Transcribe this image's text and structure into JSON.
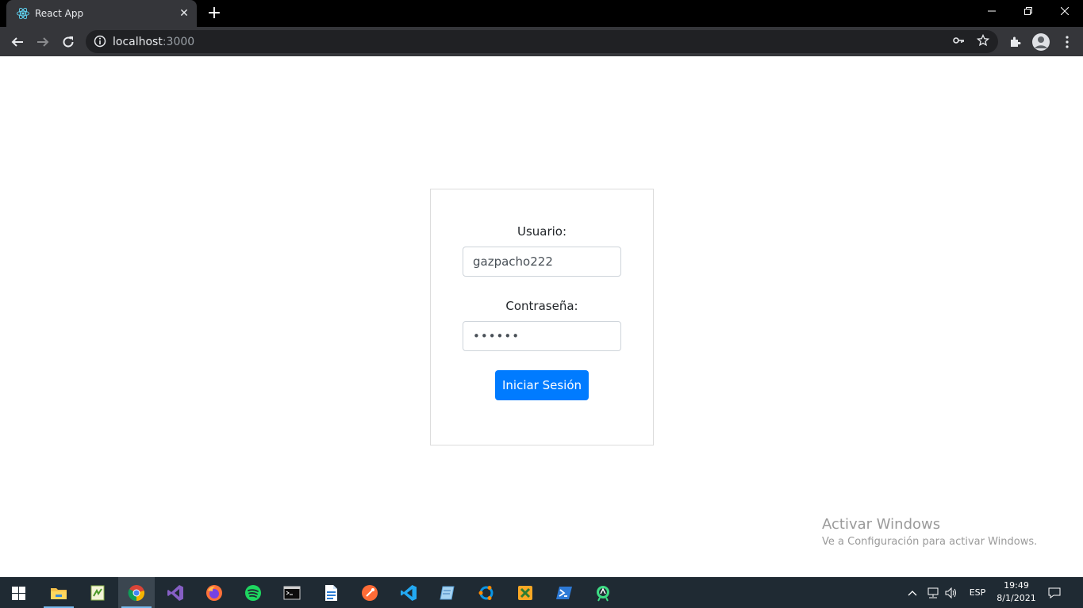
{
  "browser": {
    "tab_title": "React App",
    "url_host": "localhost",
    "url_port": ":3000"
  },
  "login": {
    "user_label": "Usuario:",
    "user_value": "gazpacho222",
    "password_label": "Contraseña:",
    "password_value": "••••••",
    "submit_label": "Iniciar Sesión"
  },
  "watermark": {
    "title": "Activar Windows",
    "subtitle": "Ve a Configuración para activar Windows."
  },
  "taskbar": {
    "language": "ESP",
    "time": "19:49",
    "date": "8/1/2021",
    "apps": [
      "file-explorer-icon",
      "notepad-plus-icon",
      "chrome-icon",
      "visual-studio-icon",
      "firefox-icon",
      "spotify-icon",
      "terminal-icon",
      "word-document-icon",
      "postman-icon",
      "vscode-icon",
      "notepad-icon",
      "ubuntu-icon",
      "xampp-icon",
      "powershell-icon",
      "android-studio-icon"
    ]
  },
  "colors": {
    "primary_button": "#007bff",
    "titlebar": "#000000",
    "toolbar": "#35363a",
    "taskbar": "#1f2a33"
  }
}
